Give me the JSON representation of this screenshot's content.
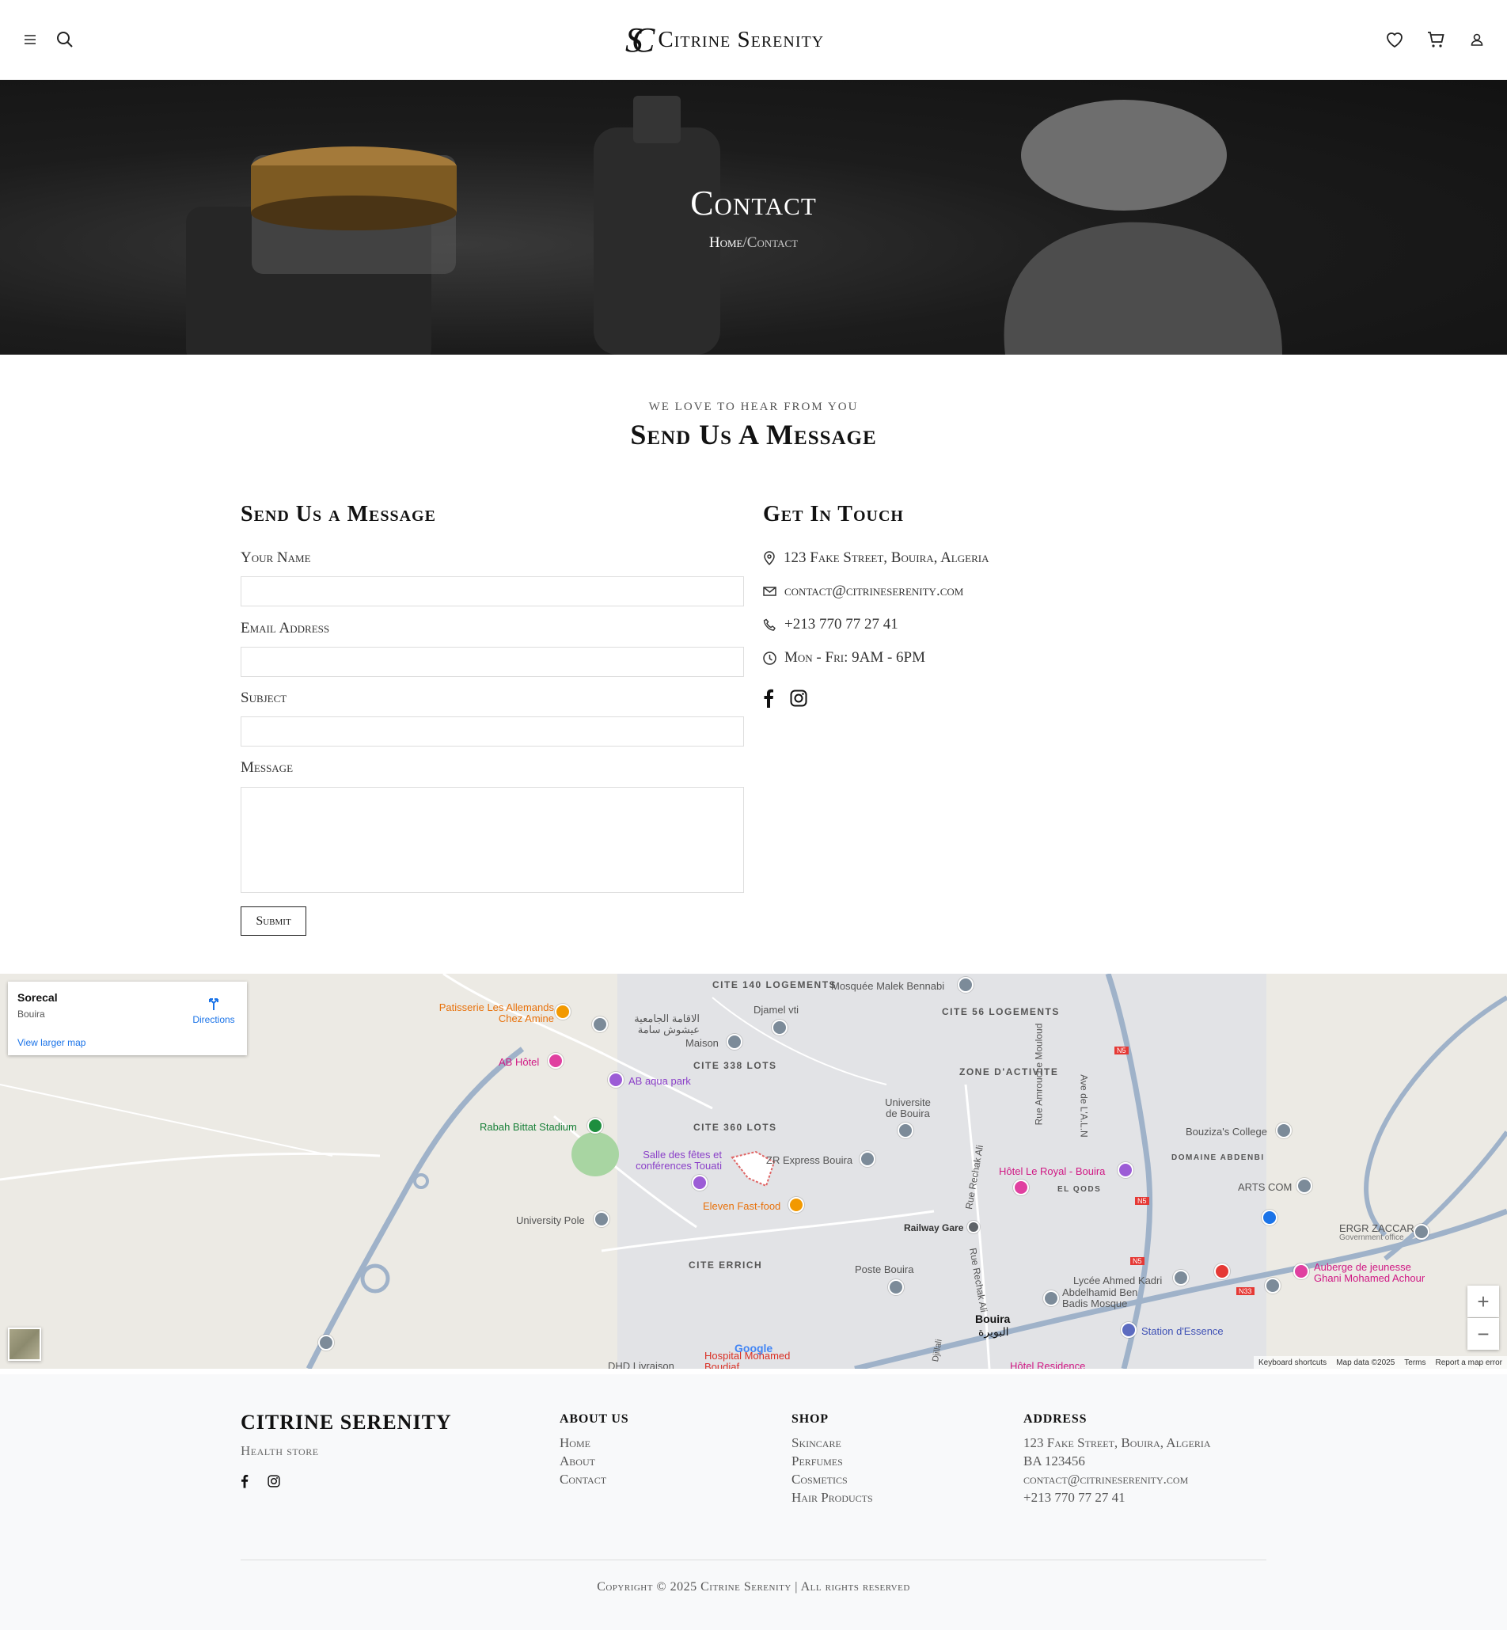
{
  "header": {
    "brand_monogram": "SC",
    "brand_name": "Citrine Serenity",
    "icons": [
      "menu-icon",
      "search-icon",
      "heart-icon",
      "cart-icon",
      "user-icon"
    ]
  },
  "hero": {
    "title": "Contact",
    "breadcrumb_home": "Home",
    "breadcrumb_separator": "/",
    "breadcrumb_current": "Contact"
  },
  "section": {
    "eyebrow": "WE LOVE TO HEAR FROM YOU",
    "title": "Send Us A Message"
  },
  "form": {
    "title": "Send Us a Message",
    "name_label": "Your Name",
    "name_value": "",
    "email_label": "Email Address",
    "email_value": "",
    "subject_label": "Subject",
    "subject_value": "",
    "message_label": "Message",
    "message_value": "",
    "submit_label": "Submit"
  },
  "contact": {
    "title": "Get In Touch",
    "address": "123 Fake Street, Bouira, Algeria",
    "email": "contact@citrineserenity.com",
    "phone": "+213 770 77 27 41",
    "hours": "Mon - Fri: 9AM - 6PM"
  },
  "map": {
    "place_name": "Sorecal",
    "place_city": "Bouira",
    "directions_label": "Directions",
    "view_larger_label": "View larger map",
    "zoom_in": "+",
    "zoom_out": "−",
    "google": "Google",
    "attribution": [
      "Keyboard shortcuts",
      "Map data ©2025",
      "Terms",
      "Report a map error"
    ],
    "areas": [
      "CITE 140 LOGEMENTS",
      "CITE 56 LOGEMENTS",
      "CITE 338 LOTS",
      "ZONE D'ACTIVITE",
      "CITE 360 LOTS",
      "DOMAINE ABDENBI",
      "EL QODS",
      "CITE ERRICH"
    ],
    "pois": [
      "Mosquée Malek Bennabi",
      "Patisserie Les Allemands Chez Amine",
      "الاقامة الجامعية عيشوش سامة",
      "Djamel vti",
      "Maison",
      "AB Hôtel",
      "AB aqua park",
      "Rabah Bittat Stadium",
      "Universite de Bouira",
      "Bouziza's College",
      "Salle des fêtes et conférences Touati",
      "ZR Express Bouira",
      "Hôtel Le Royal - Bouira",
      "ARTS COM",
      "Eleven Fast-food",
      "University Pole",
      "Railway Gare",
      "ERGR ZACCAR",
      "Government office",
      "Poste Bouira",
      "Lycée Ahmed Kadri",
      "Abdelhamid Ben Badis Mosque",
      "Auberge de jeunesse Ghani Mohamed Achour",
      "Bouira",
      "البويرة",
      "Station d'Essence",
      "Hospital Mohamed Boudiaf",
      "DHD Livraison",
      "Hôtel Residence"
    ],
    "streets": [
      "Rue Amrouche Mouloud",
      "Rue Rechak Ali",
      "Rue Rechak Ali",
      "Ave de L'A.L.N",
      "Djillali"
    ],
    "shields": [
      "N5",
      "N5",
      "N5",
      "N33"
    ]
  },
  "footer": {
    "brand": "CITRINE SERENITY",
    "tagline": "Health store",
    "about_title": "ABOUT US",
    "about_links": [
      "Home",
      "About",
      "Contact"
    ],
    "shop_title": "SHOP",
    "shop_links": [
      "Skincare",
      "Perfumes",
      "Cosmetics",
      "Hair Products"
    ],
    "address_title": "ADDRESS",
    "address_lines": [
      "123 Fake Street, Bouira, Algeria",
      "BA 123456",
      "contact@citrineserenity.com",
      "+213 770 77 27 41"
    ],
    "copyright": "Copyright © 2025 Citrine Serenity | All rights reserved"
  }
}
